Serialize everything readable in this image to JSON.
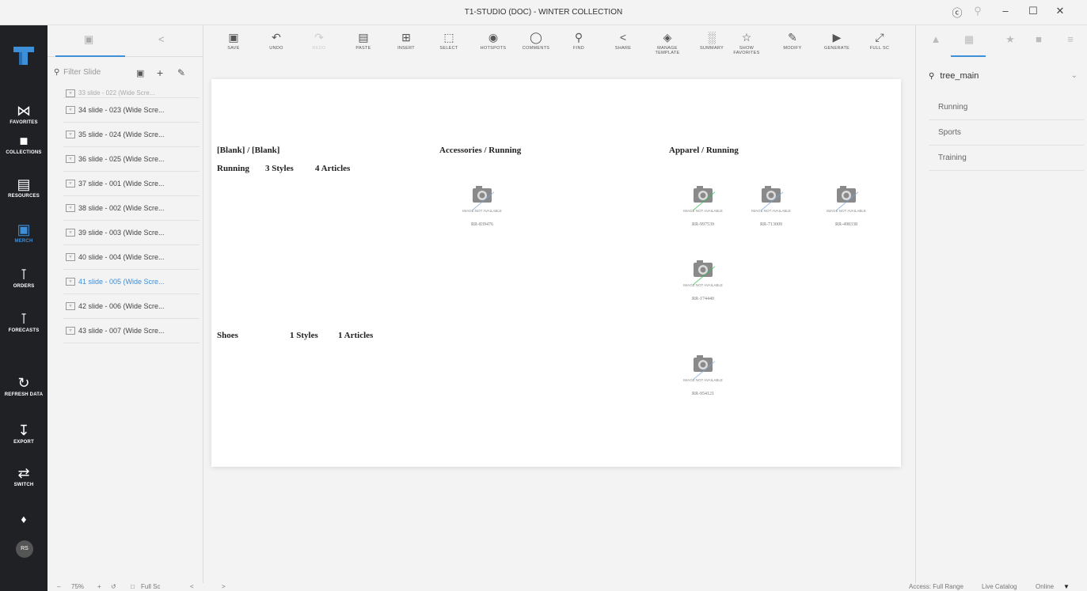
{
  "window": {
    "title": "T1-STUDIO (DOC) - WINTER COLLECTION"
  },
  "rail": [
    {
      "label": "FAVORITES",
      "icon": "bowtie-icon"
    },
    {
      "label": "COLLECTIONS",
      "icon": "folder-icon"
    },
    {
      "label": "RESOURCES",
      "icon": "stack-icon"
    },
    {
      "label": "MERCH",
      "icon": "merch-icon",
      "active": true
    },
    {
      "label": "ORDERS",
      "icon": "cart-icon"
    },
    {
      "label": "FORECASTS",
      "icon": "cart-icon"
    },
    {
      "label": "REFRESH DATA",
      "icon": "refresh-icon"
    },
    {
      "label": "EXPORT",
      "icon": "export-icon"
    },
    {
      "label": "SWITCH",
      "icon": "switch-icon"
    }
  ],
  "user_initials": "RS",
  "slides_panel": {
    "filter_placeholder": "Filter Slide",
    "partial_row": "33 slide - 022 (Wide Scre...",
    "items": [
      "34 slide - 023 (Wide Scre...",
      "35 slide - 024 (Wide Scre...",
      "36 slide - 025 (Wide Scre...",
      "37 slide - 001 (Wide Scre...",
      "38 slide - 002 (Wide Scre...",
      "39 slide - 003 (Wide Scre...",
      "40 slide - 004 (Wide Scre...",
      "41 slide - 005 (Wide Scre...",
      "42 slide - 006 (Wide Scre...",
      "43 slide - 007 (Wide Scre..."
    ],
    "active_index": 7
  },
  "toolbar": [
    {
      "label": "SAVE",
      "icon": "save-icon"
    },
    {
      "label": "UNDO",
      "icon": "undo-icon"
    },
    {
      "label": "REDO",
      "icon": "redo-icon",
      "disabled": true
    },
    {
      "label": "PASTE",
      "icon": "paste-icon"
    },
    {
      "label": "INSERT",
      "icon": "insert-icon"
    },
    {
      "label": "SELECT",
      "icon": "select-icon"
    },
    {
      "label": "HOTSPOTS",
      "icon": "hotspot-icon"
    },
    {
      "label": "COMMENTS",
      "icon": "comment-icon"
    },
    {
      "label": "FIND",
      "icon": "find-icon"
    },
    {
      "label": "SHARE",
      "icon": "share-icon"
    },
    {
      "label": "MANAGE TEMPLATE",
      "icon": "template-icon"
    },
    {
      "label": "SUMMARY",
      "icon": "summary-icon"
    },
    {
      "label": "SHOW FAVORITES",
      "icon": "star-icon"
    },
    {
      "label": "MODIFY",
      "icon": "modify-icon"
    },
    {
      "label": "GENERATE",
      "icon": "play-icon"
    },
    {
      "label": "FULL SC",
      "icon": "fullscreen-icon"
    }
  ],
  "canvas": {
    "header_blank": "[Blank] / [Blank]",
    "header_accessories": "Accessories / Running",
    "header_apparel": "Apparel / Running",
    "running_label": "Running",
    "running_styles": "3 Styles",
    "running_articles": "4 Articles",
    "shoes_label": "Shoes",
    "shoes_styles": "1 Styles",
    "shoes_articles": "1 Articles",
    "not_available": "IMAGE NOT AVAILABLE",
    "articles": [
      {
        "code": "RR-839476"
      },
      {
        "code": "RR-997539"
      },
      {
        "code": "RR-713009"
      },
      {
        "code": "RR-498338"
      },
      {
        "code": "RR-174440"
      },
      {
        "code": "RR-954121"
      }
    ]
  },
  "right_panel": {
    "tree_selector": "tree_main",
    "items": [
      "Running",
      "Sports",
      "Training"
    ]
  },
  "statusbar": {
    "zoom": "75%",
    "full_screen": "Full Sc",
    "access": "Access: Full Range",
    "catalog": "Live Catalog",
    "online": "Online"
  },
  "colors": {
    "accent": "#3d8fd8",
    "rail_bg": "#1f2125",
    "watermark_green": "#2fbf4f",
    "watermark_blue": "#7aa8d8"
  }
}
